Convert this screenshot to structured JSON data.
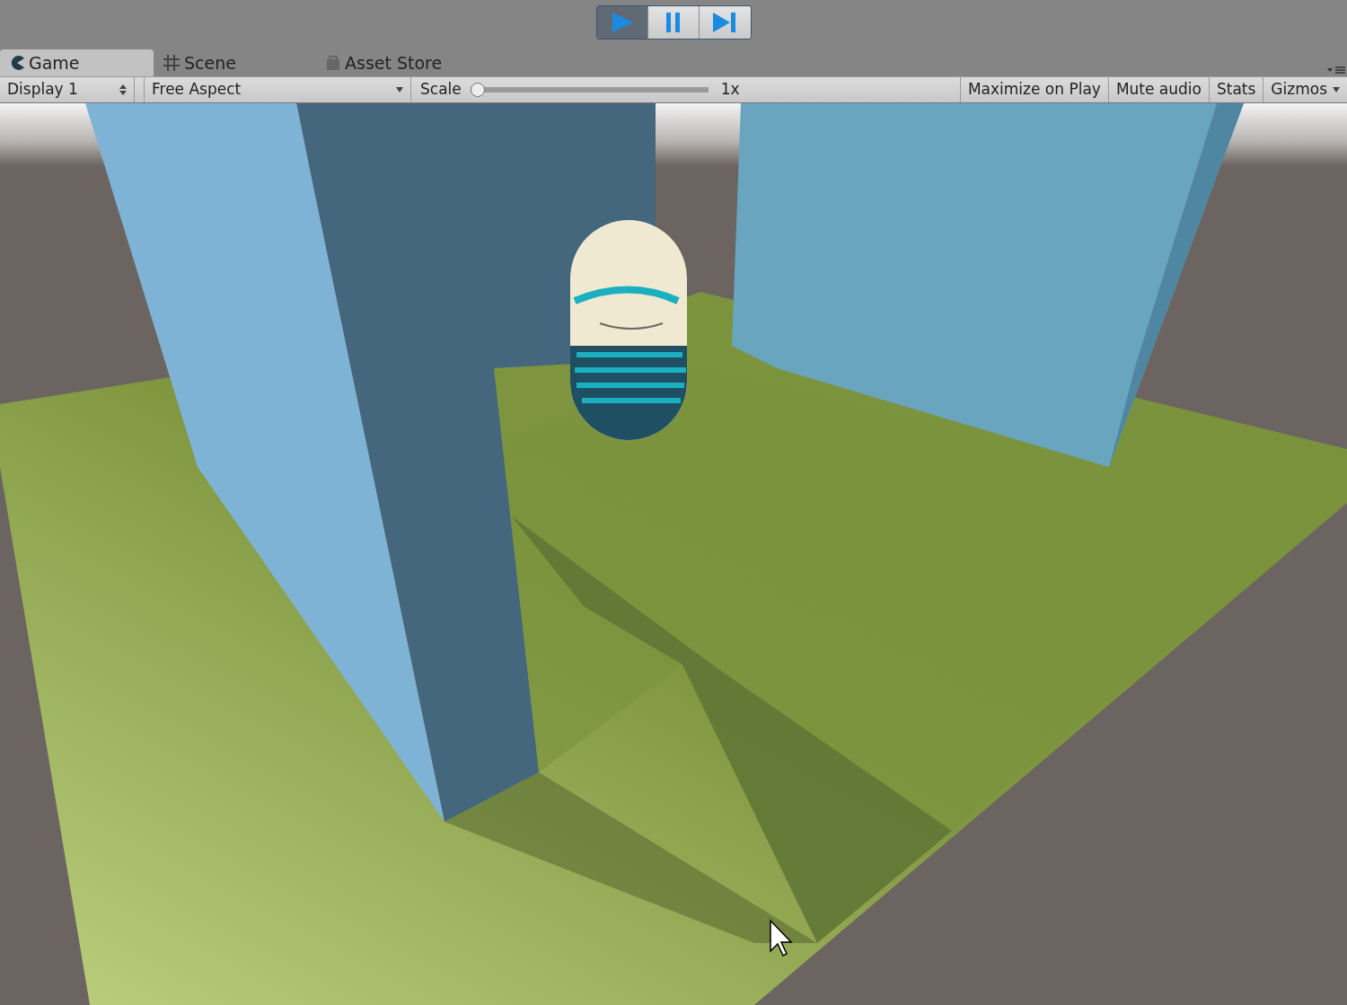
{
  "play_controls": [
    {
      "kind": "play",
      "pressed": true
    },
    {
      "kind": "pause",
      "pressed": false
    },
    {
      "kind": "step",
      "pressed": false
    }
  ],
  "tabs": [
    {
      "kind": "game",
      "label": "Game",
      "selected": true
    },
    {
      "kind": "scene",
      "label": "Scene",
      "selected": false
    },
    {
      "kind": "store",
      "label": "Asset Store",
      "selected": false
    }
  ],
  "toolbar": {
    "display": "Display 1",
    "aspect": "Free Aspect",
    "scale_label": "Scale",
    "scale": {
      "level": 0.0
    },
    "scale_reading": "1x",
    "toggles": [
      {
        "label": "Maximize on Play",
        "on": false
      },
      {
        "label": "Mute audio",
        "on": false
      },
      {
        "label": "Stats",
        "on": false
      }
    ],
    "gizmos": "Gizmos"
  }
}
